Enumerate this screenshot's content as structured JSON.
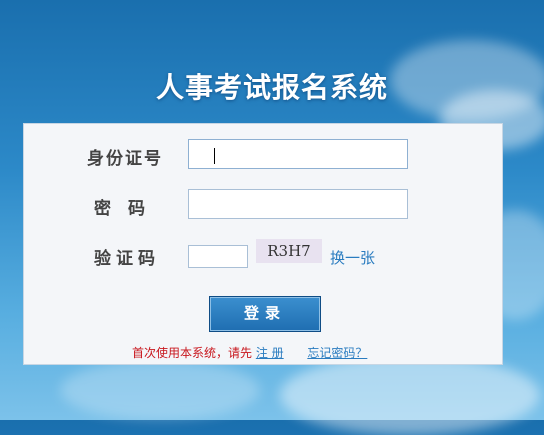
{
  "app_title": "人事考试报名系统",
  "form": {
    "id_label": "身份证号",
    "password_label": "密　码",
    "captcha_label": "验证码",
    "captcha_code": "R3H7",
    "refresh_label": "换一张",
    "login_label": "登录"
  },
  "footer": {
    "note": "首次使用本系统，请先",
    "register_label": "注 册",
    "forgot_label": "忘记密码？"
  },
  "colors": {
    "background": "#2c89c8",
    "accent": "#2a7cc0",
    "notice": "#c8161d"
  }
}
